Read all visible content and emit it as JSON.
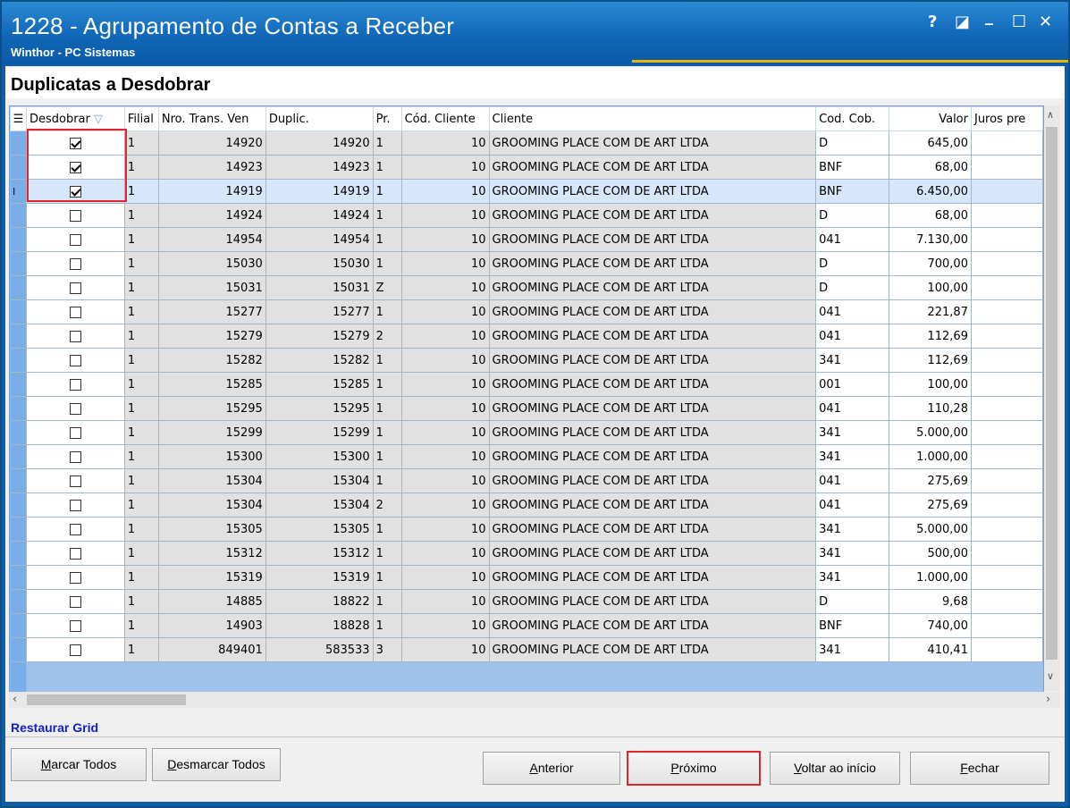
{
  "window": {
    "title": "1228 - Agrupamento de Contas a Receber",
    "subtitle": "Winthor - PC Sistemas",
    "controls": [
      "?",
      "◪",
      "_",
      "☐",
      "✕"
    ]
  },
  "section_title": "Duplicatas a Desdobrar",
  "grid": {
    "columns": [
      "Desdobrar",
      "Filial",
      "Nro. Trans. Ven",
      "Duplic.",
      "Pr.",
      "Cód. Cliente",
      "Cliente",
      "Cod. Cob.",
      "Valor",
      "Juros pre"
    ],
    "rows": [
      {
        "checked": true,
        "filial": "1",
        "trans": "14920",
        "duplic": "14920",
        "pr": "1",
        "cod_cliente": "10",
        "cliente": "GROOMING PLACE COM DE ART LTDA",
        "cod_cob": "D",
        "valor": "645,00"
      },
      {
        "checked": true,
        "filial": "1",
        "trans": "14923",
        "duplic": "14923",
        "pr": "1",
        "cod_cliente": "10",
        "cliente": "GROOMING PLACE COM DE ART LTDA",
        "cod_cob": "BNF",
        "valor": "68,00"
      },
      {
        "checked": true,
        "filial": "1",
        "trans": "14919",
        "duplic": "14919",
        "pr": "1",
        "cod_cliente": "10",
        "cliente": "GROOMING PLACE COM DE ART LTDA",
        "cod_cob": "BNF",
        "valor": "6.450,00"
      },
      {
        "checked": false,
        "filial": "1",
        "trans": "14924",
        "duplic": "14924",
        "pr": "1",
        "cod_cliente": "10",
        "cliente": "GROOMING PLACE COM DE ART LTDA",
        "cod_cob": "D",
        "valor": "68,00"
      },
      {
        "checked": false,
        "filial": "1",
        "trans": "14954",
        "duplic": "14954",
        "pr": "1",
        "cod_cliente": "10",
        "cliente": "GROOMING PLACE COM DE ART LTDA",
        "cod_cob": "041",
        "valor": "7.130,00"
      },
      {
        "checked": false,
        "filial": "1",
        "trans": "15030",
        "duplic": "15030",
        "pr": "1",
        "cod_cliente": "10",
        "cliente": "GROOMING PLACE COM DE ART LTDA",
        "cod_cob": "D",
        "valor": "700,00"
      },
      {
        "checked": false,
        "filial": "1",
        "trans": "15031",
        "duplic": "15031",
        "pr": "Z",
        "cod_cliente": "10",
        "cliente": "GROOMING PLACE COM DE ART LTDA",
        "cod_cob": "D",
        "valor": "100,00"
      },
      {
        "checked": false,
        "filial": "1",
        "trans": "15277",
        "duplic": "15277",
        "pr": "1",
        "cod_cliente": "10",
        "cliente": "GROOMING PLACE COM DE ART LTDA",
        "cod_cob": "041",
        "valor": "221,87"
      },
      {
        "checked": false,
        "filial": "1",
        "trans": "15279",
        "duplic": "15279",
        "pr": "2",
        "cod_cliente": "10",
        "cliente": "GROOMING PLACE COM DE ART LTDA",
        "cod_cob": "041",
        "valor": "112,69"
      },
      {
        "checked": false,
        "filial": "1",
        "trans": "15282",
        "duplic": "15282",
        "pr": "1",
        "cod_cliente": "10",
        "cliente": "GROOMING PLACE COM DE ART LTDA",
        "cod_cob": "341",
        "valor": "112,69"
      },
      {
        "checked": false,
        "filial": "1",
        "trans": "15285",
        "duplic": "15285",
        "pr": "1",
        "cod_cliente": "10",
        "cliente": "GROOMING PLACE COM DE ART LTDA",
        "cod_cob": "001",
        "valor": "100,00"
      },
      {
        "checked": false,
        "filial": "1",
        "trans": "15295",
        "duplic": "15295",
        "pr": "1",
        "cod_cliente": "10",
        "cliente": "GROOMING PLACE COM DE ART LTDA",
        "cod_cob": "041",
        "valor": "110,28"
      },
      {
        "checked": false,
        "filial": "1",
        "trans": "15299",
        "duplic": "15299",
        "pr": "1",
        "cod_cliente": "10",
        "cliente": "GROOMING PLACE COM DE ART LTDA",
        "cod_cob": "341",
        "valor": "5.000,00"
      },
      {
        "checked": false,
        "filial": "1",
        "trans": "15300",
        "duplic": "15300",
        "pr": "1",
        "cod_cliente": "10",
        "cliente": "GROOMING PLACE COM DE ART LTDA",
        "cod_cob": "341",
        "valor": "1.000,00"
      },
      {
        "checked": false,
        "filial": "1",
        "trans": "15304",
        "duplic": "15304",
        "pr": "1",
        "cod_cliente": "10",
        "cliente": "GROOMING PLACE COM DE ART LTDA",
        "cod_cob": "041",
        "valor": "275,69"
      },
      {
        "checked": false,
        "filial": "1",
        "trans": "15304",
        "duplic": "15304",
        "pr": "2",
        "cod_cliente": "10",
        "cliente": "GROOMING PLACE COM DE ART LTDA",
        "cod_cob": "041",
        "valor": "275,69"
      },
      {
        "checked": false,
        "filial": "1",
        "trans": "15305",
        "duplic": "15305",
        "pr": "1",
        "cod_cliente": "10",
        "cliente": "GROOMING PLACE COM DE ART LTDA",
        "cod_cob": "341",
        "valor": "5.000,00"
      },
      {
        "checked": false,
        "filial": "1",
        "trans": "15312",
        "duplic": "15312",
        "pr": "1",
        "cod_cliente": "10",
        "cliente": "GROOMING PLACE COM DE ART LTDA",
        "cod_cob": "341",
        "valor": "500,00"
      },
      {
        "checked": false,
        "filial": "1",
        "trans": "15319",
        "duplic": "15319",
        "pr": "1",
        "cod_cliente": "10",
        "cliente": "GROOMING PLACE COM DE ART LTDA",
        "cod_cob": "341",
        "valor": "1.000,00"
      },
      {
        "checked": false,
        "filial": "1",
        "trans": "14885",
        "duplic": "18822",
        "pr": "1",
        "cod_cliente": "10",
        "cliente": "GROOMING PLACE COM DE ART LTDA",
        "cod_cob": "D",
        "valor": "9,68"
      },
      {
        "checked": false,
        "filial": "1",
        "trans": "14903",
        "duplic": "18828",
        "pr": "1",
        "cod_cliente": "10",
        "cliente": "GROOMING PLACE COM DE ART LTDA",
        "cod_cob": "BNF",
        "valor": "740,00"
      },
      {
        "checked": false,
        "filial": "1",
        "trans": "849401",
        "duplic": "583533",
        "pr": "3",
        "cod_cliente": "10",
        "cliente": "GROOMING PLACE COM DE ART LTDA",
        "cod_cob": "341",
        "valor": "410,41"
      }
    ],
    "selected_row": 2
  },
  "restore_grid": "Restaurar Grid",
  "buttons": {
    "marcar_todos": {
      "mnemonic": "M",
      "rest": "arcar Todos"
    },
    "desmarcar_todos": {
      "mnemonic": "D",
      "rest": "esmarcar Todos"
    },
    "anterior": {
      "mnemonic": "A",
      "rest": "nterior"
    },
    "proximo": {
      "mnemonic": "P",
      "rest": "róximo"
    },
    "voltar": {
      "mnemonic": "V",
      "rest": "oltar ao início"
    },
    "fechar": {
      "mnemonic": "F",
      "rest": "echar"
    }
  },
  "colors": {
    "titlebar": "#1167b6",
    "accent": "#f0b400",
    "highlight": "#e0262a",
    "link": "#1020d0"
  }
}
